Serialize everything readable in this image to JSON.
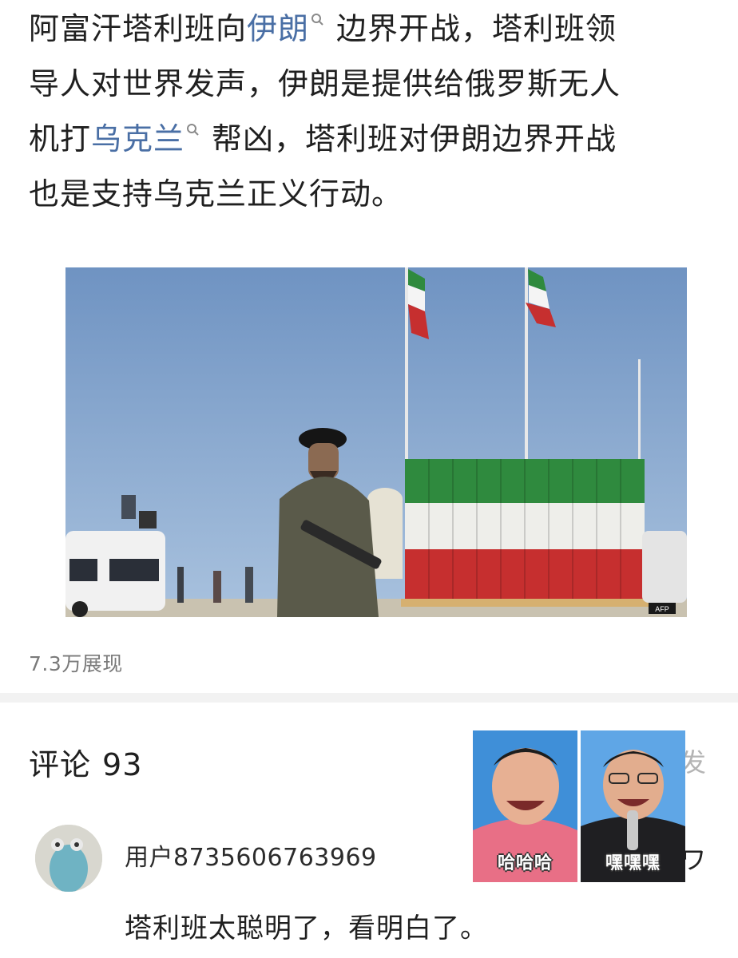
{
  "article": {
    "line1": {
      "before": "阿富汗塔利班向",
      "link": "伊朗",
      "after": "边界开战，塔利班领"
    },
    "line2": "导人对世界发声，伊朗是提供给俄罗斯无人",
    "line3": {
      "before": "机打",
      "link": "乌克兰",
      "after": "帮凶，塔利班对伊朗边界开战"
    },
    "line4": "也是支持乌克兰正义行动。"
  },
  "photo": {
    "watermark": "AFP"
  },
  "stats": {
    "views": "7.3万展现"
  },
  "comments": {
    "title": "评论",
    "count": "93",
    "partial_right_1": "发",
    "partial_right_2": "ワ",
    "items": [
      {
        "username": "用户8735606763969",
        "text": "塔利班太聪明了，看明白了。"
      }
    ]
  },
  "meme": {
    "left_caption": "哈哈哈",
    "right_caption": "嘿嘿嘿"
  },
  "colors": {
    "link": "#4a6fa5",
    "sky": "#7f9fc4",
    "flag_green": "#2f8a3e",
    "flag_red": "#c62f2f",
    "meme_bg": "#3f8fd8"
  }
}
